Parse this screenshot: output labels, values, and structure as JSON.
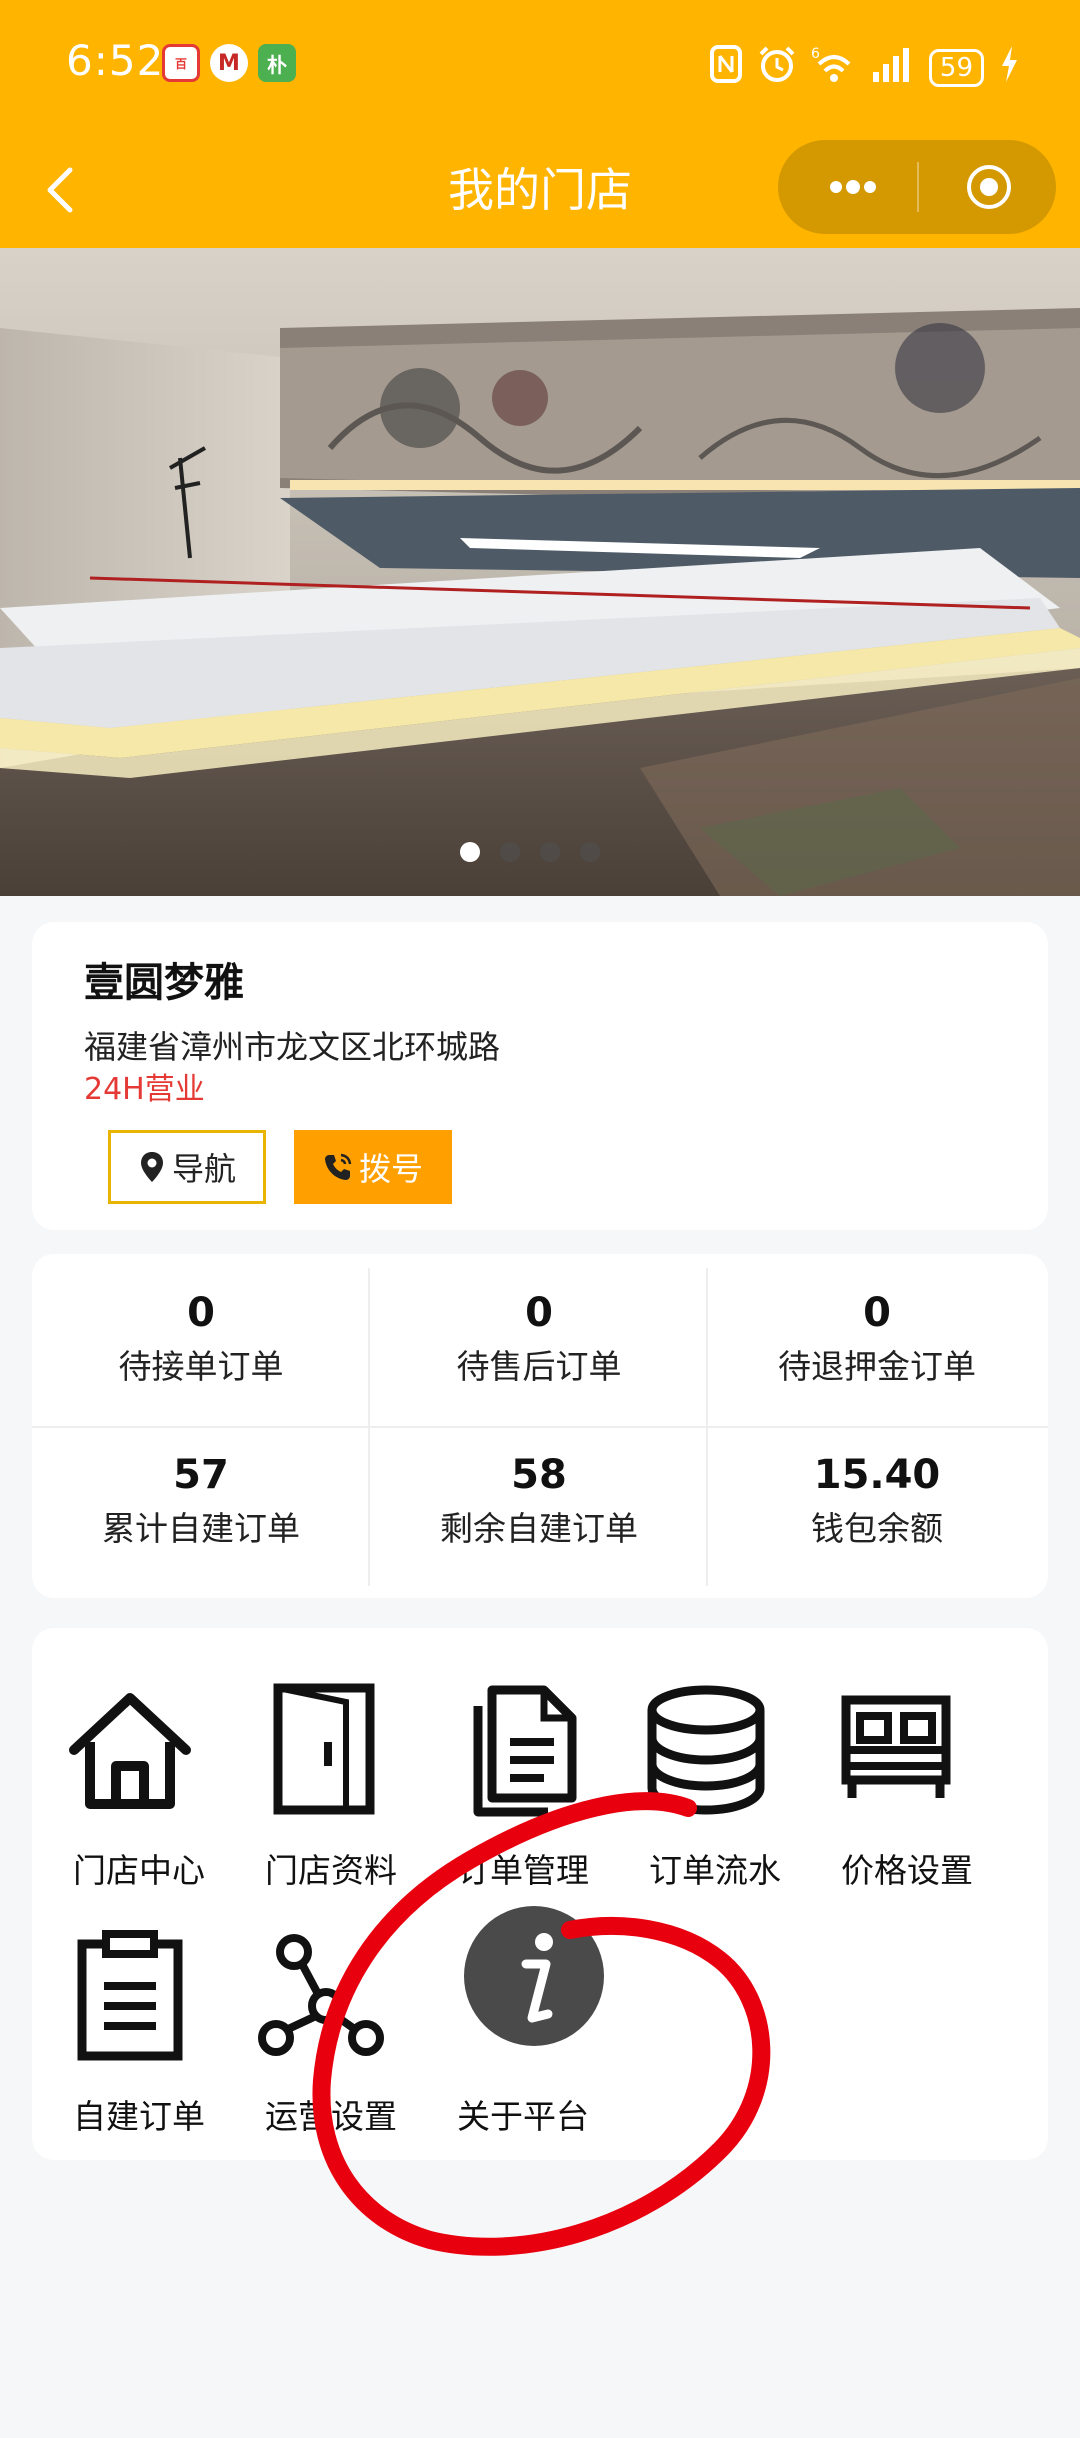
{
  "status_bar": {
    "time": "6:52",
    "notif_icons": [
      {
        "name": "app-icon-red",
        "glyph": "百"
      },
      {
        "name": "app-icon-bank",
        "glyph": "M"
      },
      {
        "name": "app-icon-green",
        "glyph": "朴"
      }
    ],
    "signal_label": "6",
    "battery": "59"
  },
  "nav": {
    "title": "我的门店"
  },
  "store": {
    "name": "壹圆梦雅",
    "address": "福建省漳州市龙文区北环城路",
    "hours": "24H营业",
    "nav_button": "导航",
    "call_button": "拨号"
  },
  "stats": [
    {
      "value": "0",
      "label": "待接单订单"
    },
    {
      "value": "0",
      "label": "待售后订单"
    },
    {
      "value": "0",
      "label": "待退押金订单"
    },
    {
      "value": "57",
      "label": "累计自建订单"
    },
    {
      "value": "58",
      "label": "剩余自建订单"
    },
    {
      "value": "15.40",
      "label": "钱包余额"
    }
  ],
  "menu": [
    {
      "label": "门店中心",
      "icon": "house-icon"
    },
    {
      "label": "门店资料",
      "icon": "door-icon"
    },
    {
      "label": "订单管理",
      "icon": "documents-icon"
    },
    {
      "label": "订单流水",
      "icon": "database-icon"
    },
    {
      "label": "价格设置",
      "icon": "bed-icon"
    },
    {
      "label": "自建订单",
      "icon": "clipboard-icon"
    },
    {
      "label": "运营设置",
      "icon": "network-icon"
    },
    {
      "label": "关于平台",
      "icon": "info-icon"
    }
  ],
  "colors": {
    "header": "#ffb400",
    "call_button": "#ffa000",
    "hours_text": "#e53935",
    "annotation": "#e8000f"
  }
}
